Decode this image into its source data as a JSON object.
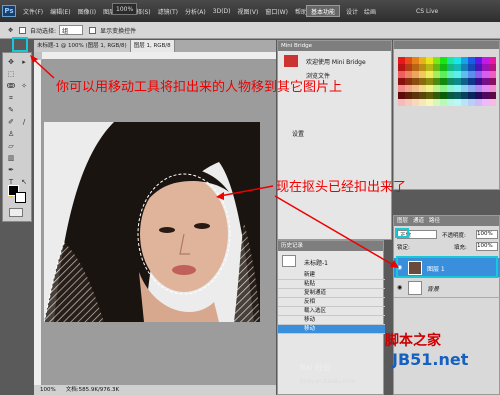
{
  "menu": {
    "logo": "Ps",
    "items": [
      "文件(F)",
      "编辑(E)",
      "图像(I)",
      "图层(L)",
      "选择(S)",
      "滤镜(T)",
      "分析(A)",
      "3D(D)",
      "视图(V)",
      "窗口(W)",
      "帮助(H)"
    ],
    "zoom": "100%",
    "workspace_button": "基本功能",
    "workspace_links": [
      "设计",
      "绘画"
    ],
    "cs_live": "CS Live"
  },
  "options": {
    "auto_select_label": "自动选择:",
    "auto_select_value": "组",
    "show_transform_label": "显示变换控件"
  },
  "document": {
    "tabs": [
      "未标题-1 @ 100% (图层 1, RGB/8)",
      "图层 1, RGB/8"
    ],
    "status_zoom": "100%",
    "status_doc": "文档:585.9K/976.3K"
  },
  "bridge": {
    "title": "Mini Bridge",
    "welcome": "欢迎使用 Mini Bridge",
    "browse_files": "浏览文件",
    "settings": "设置"
  },
  "history": {
    "title": "历史记录",
    "doc_name": "未标题-1",
    "items": [
      "新建",
      "粘贴",
      "复制通道",
      "反相",
      "载入选区",
      "移动",
      "移动"
    ],
    "active_index": 6
  },
  "layers": {
    "tabs": [
      "图层",
      "通道",
      "路径"
    ],
    "blend_mode": "正常",
    "opacity_label": "不透明度:",
    "opacity_value": "100%",
    "lock_label": "锁定:",
    "fill_label": "填充:",
    "fill_value": "100%",
    "rows": [
      {
        "name": "图层 1",
        "selected": true
      },
      {
        "name": "背景",
        "selected": false
      }
    ]
  },
  "annotations": {
    "move_tip": "你可以用移动工具将扣出来的人物移到其它图片上",
    "done_tip": "现在抠头已经扣出来了"
  },
  "watermark": {
    "baidu": "Bai 经验",
    "site_cn": "脚本之家",
    "site_url": "JB51.net",
    "site_sub": "jingyan.baidu.com"
  },
  "colors": {
    "highlight": "#19c7d6",
    "annotation": "#e00000",
    "selection": "#3a8fdc"
  }
}
